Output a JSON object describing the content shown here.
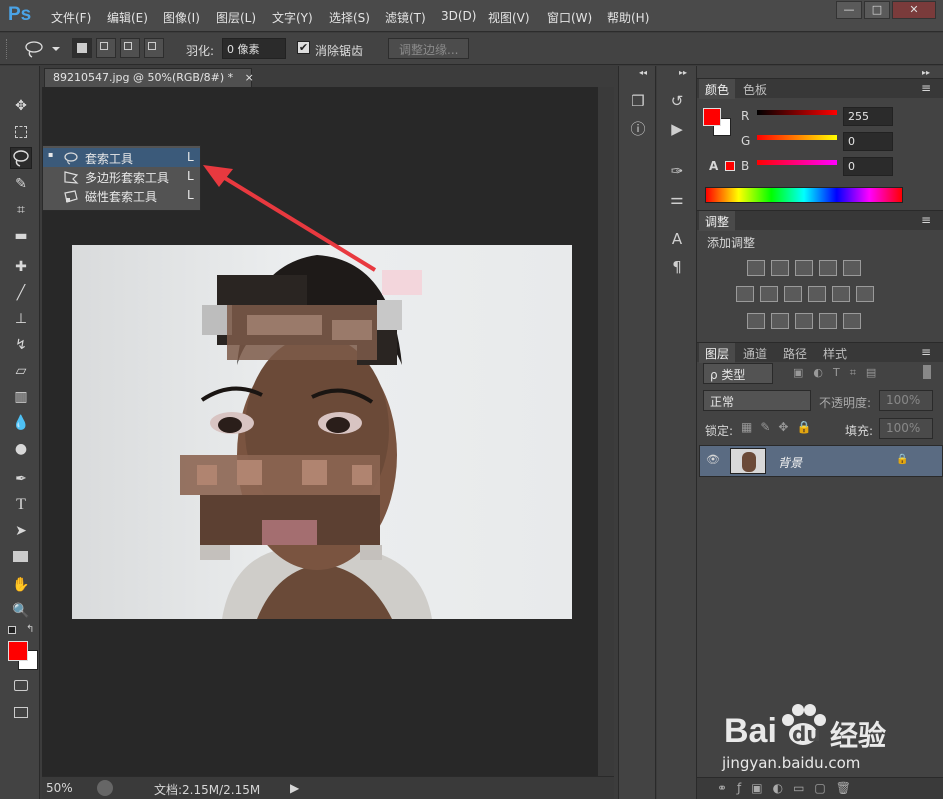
{
  "app": {
    "logo": "Ps"
  },
  "menu": [
    "文件(F)",
    "编辑(E)",
    "图像(I)",
    "图层(L)",
    "文字(Y)",
    "选择(S)",
    "滤镜(T)",
    "3D(D)",
    "视图(V)",
    "窗口(W)",
    "帮助(H)"
  ],
  "window_controls": {
    "minimize": "—",
    "maximize": "□",
    "close": "✕"
  },
  "options": {
    "feather_label": "羽化:",
    "feather_value": "0 像素",
    "antialias_label": "消除锯齿",
    "antialias_checked": "✔",
    "refine_edge": "调整边缘..."
  },
  "document": {
    "tab_title": "89210547.jpg @ 50%(RGB/8#) *",
    "tab_close": "×",
    "zoom": "50%",
    "doc_info": "文档:2.15M/2.15M",
    "status_arrow": "▶"
  },
  "flyout": {
    "items": [
      {
        "label": "套索工具",
        "shortcut": "L",
        "marker": "▪"
      },
      {
        "label": "多边形套索工具",
        "shortcut": "L",
        "marker": ""
      },
      {
        "label": "磁性套索工具",
        "shortcut": "L",
        "marker": ""
      }
    ]
  },
  "color_panel": {
    "tabs": [
      "颜色",
      "色板"
    ],
    "r_label": "R",
    "r_value": "255",
    "g_label": "G",
    "g_value": "0",
    "b_label": "B",
    "b_value": "0",
    "warning": "A"
  },
  "adjust_panel": {
    "tab": "调整",
    "title": "添加调整"
  },
  "layers_panel": {
    "tabs": [
      "图层",
      "通道",
      "路径",
      "样式"
    ],
    "filter_label": "ρ 类型",
    "blend_mode": "正常",
    "opacity_label": "不透明度:",
    "opacity_value": "100%",
    "lock_label": "锁定:",
    "fill_label": "填充:",
    "fill_value": "100%",
    "layer_name": "背景",
    "eye": "👁",
    "lock_icon": "🔒"
  },
  "panel_arrows": {
    "collapse": "◂◂",
    "expand": "▸▸"
  },
  "watermark": {
    "brand": "Bai",
    "brand2": "du",
    "cn": "经验",
    "url": "jingyan.baidu.com"
  },
  "colors": {
    "foreground": "#ff0000",
    "background": "#ffffff",
    "selection": "#3b5a7a",
    "arrow": "#e8393f"
  }
}
